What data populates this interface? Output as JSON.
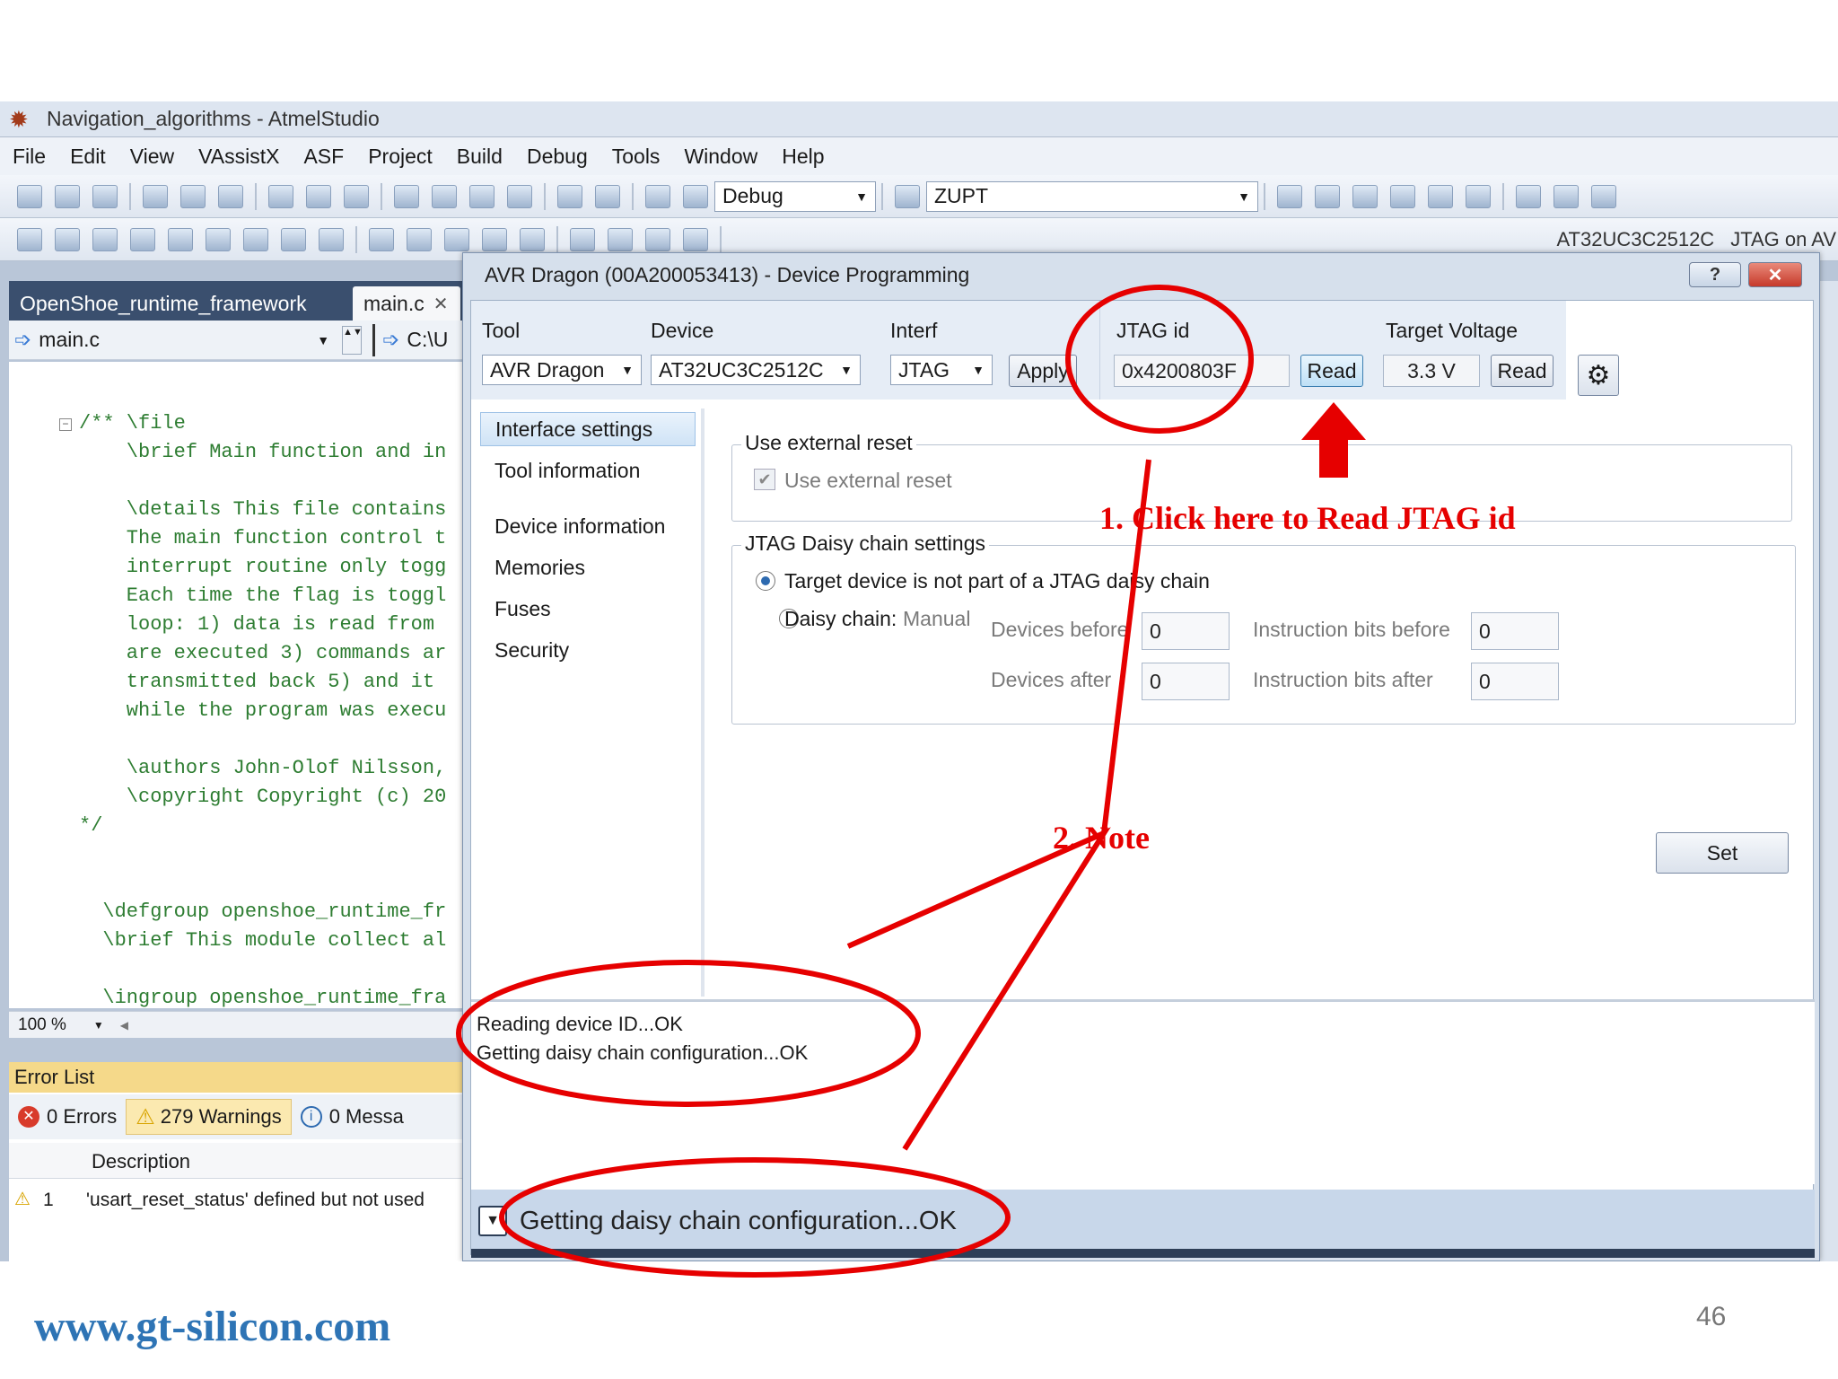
{
  "window": {
    "title": "Navigation_algorithms - AtmelStudio"
  },
  "menu": [
    "File",
    "Edit",
    "View",
    "VAssistX",
    "ASF",
    "Project",
    "Build",
    "Debug",
    "Tools",
    "Window",
    "Help"
  ],
  "toolbar": {
    "config_combo": "Debug",
    "platform_combo": "ZUPT",
    "device_label": "AT32UC3C2512C",
    "tool_label": "JTAG on AV"
  },
  "editor": {
    "tabs": [
      "OpenShoe_runtime_framework",
      "main.c"
    ],
    "nav_combo": "main.c",
    "nav_path": "C:\\U",
    "zoom": "100 %",
    "code_lines": [
      "/** \\file",
      "    \\brief Main function and in",
      "",
      "    \\details This file contains",
      "    The main function control t",
      "    interrupt routine only togg",
      "    Each time the flag is toggl",
      "    loop: 1) data is read from",
      "    are executed 3) commands ar",
      "    transmitted back 5) and it",
      "    while the program was execu",
      "",
      "    \\authors John-Olof Nilsson,",
      "    \\copyright Copyright (c) 20",
      "*/",
      "",
      "/**",
      "  \\defgroup openshoe_runtime_fr",
      "  \\brief This module collect al",
      "",
      "  \\ingroup openshoe_runtime_fra"
    ]
  },
  "error_list": {
    "title": "Error List",
    "errors": "0 Errors",
    "warnings": "279 Warnings",
    "messages": "0 Messa",
    "col_description": "Description",
    "row1_num": "1",
    "row1_text": "'usart_reset_status' defined but not used"
  },
  "dialog": {
    "title": "AVR Dragon (00A200053413) - Device Programming",
    "help_btn": "?",
    "tool_label": "Tool",
    "tool_value": "AVR Dragon",
    "device_label": "Device",
    "device_value": "AT32UC3C2512C",
    "interface_label": "Interface",
    "interface_value": "JTAG",
    "apply": "Apply",
    "jtag_label": "JTAG id",
    "jtag_value": "0x4200803F",
    "read1": "Read",
    "voltage_label": "Target Voltage",
    "voltage_value": "3.3 V",
    "read2": "Read",
    "nav": [
      "Interface settings",
      "Tool information",
      "Device information",
      "Memories",
      "Fuses",
      "Security"
    ],
    "ext_reset_group": "Use external reset",
    "ext_reset_check": "Use external reset",
    "daisy_group": "JTAG Daisy chain settings",
    "radio1": "Target device is not part of a JTAG daisy chain",
    "radio2": "Daisy chain:",
    "radio2_mode": "Manual",
    "devices_before": "Devices before",
    "devices_after": "Devices after",
    "ibits_before": "Instruction bits before",
    "ibits_after": "Instruction bits after",
    "devices_before_val": "0",
    "devices_after_val": "0",
    "ibits_before_val": "0",
    "ibits_after_val": "0",
    "set": "Set",
    "log1": "Reading device ID...OK",
    "log2": "Getting daisy chain configuration...OK",
    "status": "Getting daisy chain configuration...OK"
  },
  "annotations": {
    "step1": "1. Click here to Read JTAG id",
    "step2": "2. Note",
    "color": "#e60000"
  },
  "footer": {
    "site": "www.gt-silicon.com",
    "page": "46"
  }
}
